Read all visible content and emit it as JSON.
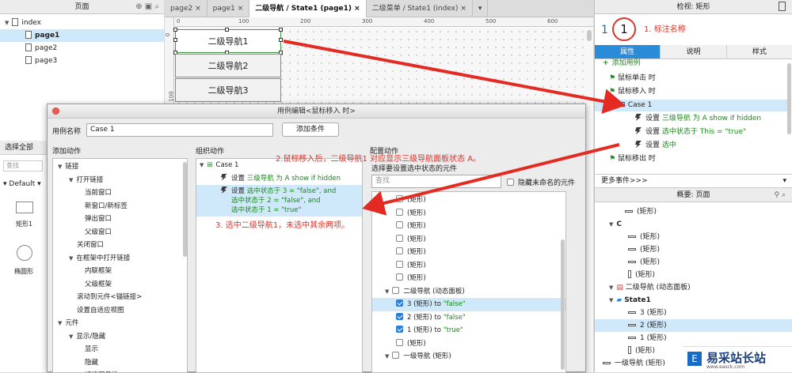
{
  "pages_panel": {
    "title": "页面",
    "tree": [
      {
        "label": "index",
        "level": 0,
        "selected": false
      },
      {
        "label": "page1",
        "level": 1,
        "selected": true
      },
      {
        "label": "page2",
        "level": 1,
        "selected": false
      },
      {
        "label": "page3",
        "level": 1,
        "selected": false
      }
    ]
  },
  "left_lower": {
    "select_all": "选择全部",
    "search_placeholder": "查找",
    "library": "Default",
    "widgets": [
      {
        "label": "矩形1"
      },
      {
        "label": "椭圆形"
      }
    ]
  },
  "tabs": [
    {
      "label": "page2",
      "active": false
    },
    {
      "label": "page1",
      "active": false
    },
    {
      "label": "二级导航 / State1 (page1)",
      "active": true
    },
    {
      "label": "二级菜单 / State1 (index)",
      "active": false
    }
  ],
  "ruler": {
    "h_ticks": [
      "0",
      "100",
      "200",
      "300",
      "400",
      "500",
      "600"
    ],
    "v_ticks": [
      "0",
      "100"
    ]
  },
  "canvas_items": [
    {
      "label": "二级导航1"
    },
    {
      "label": "二级导航2"
    },
    {
      "label": "二级导航3"
    }
  ],
  "inspector": {
    "title": "检视: 矩形",
    "count": "1",
    "circled": "1",
    "annotation": "1. 标注名称",
    "tabs": [
      "属性",
      "说明",
      "样式"
    ],
    "add_case": "添加用例",
    "events": [
      {
        "label": "鼠标单击 时"
      },
      {
        "label": "鼠标移入 时"
      },
      {
        "label": "Case 1"
      },
      {
        "prefix": "设置 ",
        "green": "三级导航 为 A show if hidden"
      },
      {
        "prefix": "设置 ",
        "green": "选中状态于 This = \"true\""
      },
      {
        "prefix": "设置 ",
        "green": "选中"
      },
      {
        "label": "鼠标移出 时"
      }
    ],
    "more_events": "更多事件>>>"
  },
  "outline": {
    "title": "概要: 页面",
    "items": [
      {
        "label": "(矩形)"
      },
      {
        "label": "C"
      },
      {
        "label": "(矩形)"
      },
      {
        "label": "(矩形)"
      },
      {
        "label": "(矩形)"
      },
      {
        "label": "(矩形)"
      },
      {
        "label": "二级导航 (动态面板)"
      },
      {
        "label": "State1"
      },
      {
        "label": "3 (矩形)"
      },
      {
        "label": "2 (矩形)"
      },
      {
        "label": "1 (矩形)"
      },
      {
        "label": "(矩形)"
      },
      {
        "label": "一级导航 (矩形)"
      }
    ]
  },
  "dialog": {
    "title": "用例编辑<鼠标移入 时>",
    "case_name_label": "用例名称",
    "case_name_value": "Case 1",
    "add_condition": "添加条件",
    "col1_title": "添加动作",
    "col2_title": "组织动作",
    "col3_title": "配置动作",
    "actions": [
      {
        "label": "链接",
        "level": 0
      },
      {
        "label": "打开链接",
        "level": 1
      },
      {
        "label": "当前窗口",
        "level": 2
      },
      {
        "label": "新窗口/新标签",
        "level": 2
      },
      {
        "label": "弹出窗口",
        "level": 2
      },
      {
        "label": "父级窗口",
        "level": 2
      },
      {
        "label": "关闭窗口",
        "level": 1
      },
      {
        "label": "在框架中打开链接",
        "level": 1
      },
      {
        "label": "内联框架",
        "level": 2
      },
      {
        "label": "父级框架",
        "level": 2
      },
      {
        "label": "滚动到元件<锚链接>",
        "level": 1
      },
      {
        "label": "设置自适应视图",
        "level": 1
      },
      {
        "label": "元件",
        "level": 0
      },
      {
        "label": "显示/隐藏",
        "level": 1
      },
      {
        "label": "显示",
        "level": 2
      },
      {
        "label": "隐藏",
        "level": 2
      },
      {
        "label": "切换可见性",
        "level": 2
      }
    ],
    "org": {
      "case_label": "Case 1",
      "action1_prefix": "设置 ",
      "action1_green": "三级导航 为 A show if hidden",
      "action2_prefix": "设置 ",
      "action2_line1": "选中状态于 3 = \"false\", and",
      "action2_line2": "选中状态于 2 = \"false\", and",
      "action2_line3": "选中状态于 1 = \"true\""
    },
    "config": {
      "subtitle": "选择要设置选中状态的元件",
      "search_placeholder": "查找",
      "hide_unnamed": "隐藏未命名的元件",
      "rows": [
        {
          "label": "(矩形)",
          "checked": false,
          "hl": false,
          "group": false,
          "suffix": ""
        },
        {
          "label": "(矩形)",
          "checked": false,
          "hl": false,
          "group": false,
          "suffix": ""
        },
        {
          "label": "(矩形)",
          "checked": false,
          "hl": false,
          "group": false,
          "suffix": ""
        },
        {
          "label": "(矩形)",
          "checked": false,
          "hl": false,
          "group": false,
          "suffix": ""
        },
        {
          "label": "(矩形)",
          "checked": false,
          "hl": false,
          "group": false,
          "suffix": ""
        },
        {
          "label": "(矩形)",
          "checked": false,
          "hl": false,
          "group": false,
          "suffix": ""
        },
        {
          "label": "(矩形)",
          "checked": false,
          "hl": false,
          "group": false,
          "suffix": ""
        },
        {
          "label": "二级导航 (动态面板)",
          "checked": false,
          "hl": false,
          "group": true,
          "suffix": ""
        },
        {
          "label": "3 (矩形) to ",
          "checked": true,
          "hl": true,
          "group": false,
          "suffix": "\"false\""
        },
        {
          "label": "2 (矩形) to ",
          "checked": true,
          "hl": false,
          "group": false,
          "suffix": "\"false\""
        },
        {
          "label": "1 (矩形) to ",
          "checked": true,
          "hl": false,
          "group": false,
          "suffix": "\"true\""
        },
        {
          "label": "(矩形)",
          "checked": false,
          "hl": false,
          "group": false,
          "suffix": ""
        },
        {
          "label": "一级导航 (矩形)",
          "checked": false,
          "hl": false,
          "group": true,
          "suffix": ""
        }
      ]
    }
  },
  "annotations": {
    "a2": "2.鼠标移入后，二级导航1 对应显示三级导航面板状态 A。",
    "a3": "3. 选中二级导航1，未选中其余两项。"
  },
  "watermark": {
    "brand": "易采站长站",
    "url": "www.easck.com"
  },
  "colors": {
    "accent": "#2a8bd8",
    "annotation_red": "#d8352a",
    "action_green": "#1a8a1a",
    "selection": "#cfe8fa"
  }
}
